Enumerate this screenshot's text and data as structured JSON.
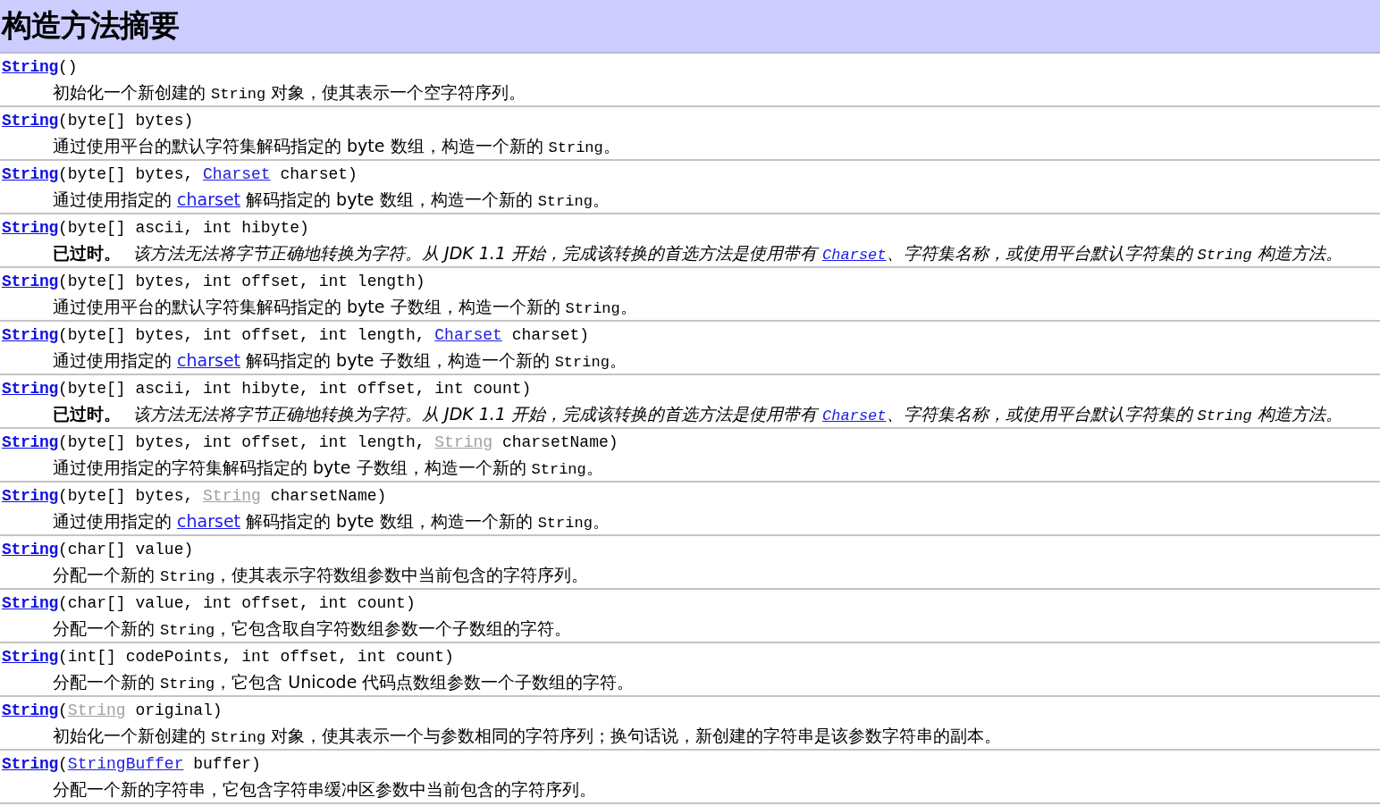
{
  "title": "构造方法摘要",
  "rows": [
    {
      "signature": [
        {
          "kind": "name",
          "text": "String"
        },
        {
          "kind": "plain",
          "text": "()"
        }
      ],
      "deprecated": false,
      "description": [
        {
          "kind": "text",
          "text": "初始化一个新创建的 "
        },
        {
          "kind": "code",
          "text": "String"
        },
        {
          "kind": "text",
          "text": " 对象，使其表示一个空字符序列。"
        }
      ]
    },
    {
      "signature": [
        {
          "kind": "name",
          "text": "String"
        },
        {
          "kind": "plain",
          "text": "(byte[] bytes)"
        }
      ],
      "deprecated": false,
      "description": [
        {
          "kind": "text",
          "text": "通过使用平台的默认字符集解码指定的 byte 数组，构造一个新的 "
        },
        {
          "kind": "code",
          "text": "String"
        },
        {
          "kind": "text",
          "text": "。"
        }
      ]
    },
    {
      "signature": [
        {
          "kind": "name",
          "text": "String"
        },
        {
          "kind": "plain",
          "text": "(byte[] bytes, "
        },
        {
          "kind": "link",
          "text": "Charset"
        },
        {
          "kind": "plain",
          "text": " charset)"
        }
      ],
      "deprecated": false,
      "description": [
        {
          "kind": "text",
          "text": "通过使用指定的 "
        },
        {
          "kind": "link",
          "text": "charset"
        },
        {
          "kind": "text",
          "text": " 解码指定的 byte 数组，构造一个新的 "
        },
        {
          "kind": "code",
          "text": "String"
        },
        {
          "kind": "text",
          "text": "。"
        }
      ]
    },
    {
      "signature": [
        {
          "kind": "name",
          "text": "String"
        },
        {
          "kind": "plain",
          "text": "(byte[] ascii, int hibyte)"
        }
      ],
      "deprecated": true,
      "deprecated_label": "已过时。",
      "description": [
        {
          "kind": "text",
          "text": "该方法无法将字节正确地转换为字符。从 JDK 1.1 开始，完成该转换的首选方法是使用带有 "
        },
        {
          "kind": "code-link",
          "text": "Charset"
        },
        {
          "kind": "text",
          "text": "、字符集名称，或使用平台默认字符集的 "
        },
        {
          "kind": "code",
          "text": "String"
        },
        {
          "kind": "text",
          "text": " 构造方法。"
        }
      ]
    },
    {
      "signature": [
        {
          "kind": "name",
          "text": "String"
        },
        {
          "kind": "plain",
          "text": "(byte[] bytes, int offset, int length)"
        }
      ],
      "deprecated": false,
      "description": [
        {
          "kind": "text",
          "text": "通过使用平台的默认字符集解码指定的 byte 子数组，构造一个新的 "
        },
        {
          "kind": "code",
          "text": "String"
        },
        {
          "kind": "text",
          "text": "。"
        }
      ]
    },
    {
      "signature": [
        {
          "kind": "name",
          "text": "String"
        },
        {
          "kind": "plain",
          "text": "(byte[] bytes, int offset, int length, "
        },
        {
          "kind": "link",
          "text": "Charset"
        },
        {
          "kind": "plain",
          "text": " charset)"
        }
      ],
      "deprecated": false,
      "description": [
        {
          "kind": "text",
          "text": "通过使用指定的 "
        },
        {
          "kind": "link",
          "text": "charset"
        },
        {
          "kind": "text",
          "text": " 解码指定的 byte 子数组，构造一个新的 "
        },
        {
          "kind": "code",
          "text": "String"
        },
        {
          "kind": "text",
          "text": "。"
        }
      ]
    },
    {
      "signature": [
        {
          "kind": "name",
          "text": "String"
        },
        {
          "kind": "plain",
          "text": "(byte[] ascii, int hibyte, int offset, int count)"
        }
      ],
      "deprecated": true,
      "deprecated_label": "已过时。",
      "description": [
        {
          "kind": "text",
          "text": "该方法无法将字节正确地转换为字符。从 JDK 1.1 开始，完成该转换的首选方法是使用带有 "
        },
        {
          "kind": "code-link",
          "text": "Charset"
        },
        {
          "kind": "text",
          "text": "、字符集名称，或使用平台默认字符集的 "
        },
        {
          "kind": "code",
          "text": "String"
        },
        {
          "kind": "text",
          "text": " 构造方法。"
        }
      ]
    },
    {
      "signature": [
        {
          "kind": "name",
          "text": "String"
        },
        {
          "kind": "plain",
          "text": "(byte[] bytes, int offset, int length, "
        },
        {
          "kind": "visited-link",
          "text": "String"
        },
        {
          "kind": "plain",
          "text": " charsetName)"
        }
      ],
      "deprecated": false,
      "description": [
        {
          "kind": "text",
          "text": "通过使用指定的字符集解码指定的 byte 子数组，构造一个新的 "
        },
        {
          "kind": "code",
          "text": "String"
        },
        {
          "kind": "text",
          "text": "。"
        }
      ]
    },
    {
      "signature": [
        {
          "kind": "name",
          "text": "String"
        },
        {
          "kind": "plain",
          "text": "(byte[] bytes, "
        },
        {
          "kind": "visited-link",
          "text": "String"
        },
        {
          "kind": "plain",
          "text": " charsetName)"
        }
      ],
      "deprecated": false,
      "description": [
        {
          "kind": "text",
          "text": "通过使用指定的 "
        },
        {
          "kind": "link",
          "text": "charset"
        },
        {
          "kind": "text",
          "text": " 解码指定的 byte 数组，构造一个新的 "
        },
        {
          "kind": "code",
          "text": "String"
        },
        {
          "kind": "text",
          "text": "。"
        }
      ]
    },
    {
      "signature": [
        {
          "kind": "name",
          "text": "String"
        },
        {
          "kind": "plain",
          "text": "(char[] value)"
        }
      ],
      "deprecated": false,
      "description": [
        {
          "kind": "text",
          "text": "分配一个新的 "
        },
        {
          "kind": "code",
          "text": "String"
        },
        {
          "kind": "text",
          "text": "，使其表示字符数组参数中当前包含的字符序列。"
        }
      ]
    },
    {
      "signature": [
        {
          "kind": "name",
          "text": "String"
        },
        {
          "kind": "plain",
          "text": "(char[] value, int offset, int count)"
        }
      ],
      "deprecated": false,
      "description": [
        {
          "kind": "text",
          "text": "分配一个新的 "
        },
        {
          "kind": "code",
          "text": "String"
        },
        {
          "kind": "text",
          "text": "，它包含取自字符数组参数一个子数组的字符。"
        }
      ]
    },
    {
      "signature": [
        {
          "kind": "name",
          "text": "String"
        },
        {
          "kind": "plain",
          "text": "(int[] codePoints, int offset, int count)"
        }
      ],
      "deprecated": false,
      "description": [
        {
          "kind": "text",
          "text": "分配一个新的 "
        },
        {
          "kind": "code",
          "text": "String"
        },
        {
          "kind": "text",
          "text": "，它包含 Unicode 代码点数组参数一个子数组的字符。"
        }
      ]
    },
    {
      "signature": [
        {
          "kind": "name",
          "text": "String"
        },
        {
          "kind": "plain",
          "text": "("
        },
        {
          "kind": "visited-link",
          "text": "String"
        },
        {
          "kind": "plain",
          "text": " original)"
        }
      ],
      "deprecated": false,
      "description": [
        {
          "kind": "text",
          "text": "初始化一个新创建的 "
        },
        {
          "kind": "code",
          "text": "String"
        },
        {
          "kind": "text",
          "text": " 对象，使其表示一个与参数相同的字符序列；换句话说，新创建的字符串是该参数字符串的副本。"
        }
      ]
    },
    {
      "signature": [
        {
          "kind": "name",
          "text": "String"
        },
        {
          "kind": "plain",
          "text": "("
        },
        {
          "kind": "link",
          "text": "StringBuffer"
        },
        {
          "kind": "plain",
          "text": " buffer)"
        }
      ],
      "deprecated": false,
      "description": [
        {
          "kind": "text",
          "text": "分配一个新的字符串，它包含字符串缓冲区参数中当前包含的字符序列。"
        }
      ]
    }
  ]
}
